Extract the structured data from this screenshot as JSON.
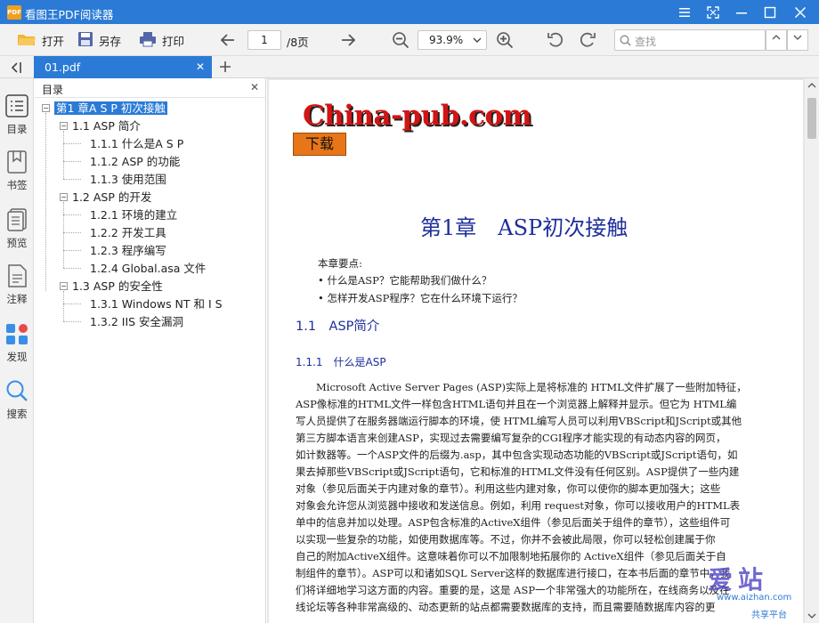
{
  "window": {
    "title": "看图王PDF阅读器",
    "app_icon": "PDF"
  },
  "toolbar": {
    "open_label": "打开",
    "save_label": "另存",
    "print_label": "打印",
    "page_current": "1",
    "page_total": "/8页",
    "zoom": "93.9%",
    "search_placeholder": "查找"
  },
  "tabs": [
    {
      "label": "01.pdf"
    }
  ],
  "rail": {
    "toc": "目录",
    "bookmark": "书签",
    "preview": "预览",
    "annotate": "注释",
    "discover": "发现",
    "search": "搜索"
  },
  "outline": {
    "title": "目录",
    "items": [
      {
        "label": "第1 章A S P 初次接触",
        "level": 0,
        "selected": true
      },
      {
        "label": "1.1 ASP 简介",
        "level": 1
      },
      {
        "label": "1.1.1 什么是A S P",
        "level": 2
      },
      {
        "label": "1.1.2 ASP 的功能",
        "level": 2
      },
      {
        "label": "1.1.3 使用范围",
        "level": 2
      },
      {
        "label": "1.2 ASP 的开发",
        "level": 1
      },
      {
        "label": "1.2.1 环境的建立",
        "level": 2
      },
      {
        "label": "1.2.2 开发工具",
        "level": 2
      },
      {
        "label": "1.2.3 程序编写",
        "level": 2
      },
      {
        "label": "1.2.4 Global.asa 文件",
        "level": 2
      },
      {
        "label": "1.3 ASP 的安全性",
        "level": 1
      },
      {
        "label": "1.3.1 Windows NT 和 I S",
        "level": 2
      },
      {
        "label": "1.3.2 IIS 安全漏洞",
        "level": 2
      }
    ]
  },
  "document": {
    "logo": "China-pub.com",
    "download": "下载",
    "chapter_title": "第1章　ASP初次接触",
    "key_head": "本章要点:",
    "key_points": [
      "• 什么是ASP？它能帮助我们做什么？",
      "• 怎样开发ASP程序？它在什么环境下运行？"
    ],
    "sec_1_1": "1.1　ASP简介",
    "sec_1_1_1": "1.1.1　什么是ASP",
    "paragraph_lines": [
      "　　Microsoft Active Server Pages (ASP)实际上是将标准的 HTML文件扩展了一些附加特征，",
      "ASP像标准的HTML文件一样包含HTML语句并且在一个浏览器上解释并显示。但它为 HTML编",
      "写人员提供了在服务器端运行脚本的环境，使 HTML编写人员可以利用VBScript和JScript或其他",
      "第三方脚本语言来创建ASP，实现过去需要编写复杂的CGI程序才能实现的有动态内容的网页，",
      "如计数器等。一个ASP文件的后缀为.asp，其中包含实现动态功能的VBScript或JScript语句，如",
      "果去掉那些VBScript或JScript语句，它和标准的HTML文件没有任何区别。ASP提供了一些内建",
      "对象（参见后面关于内建对象的章节）。利用这些内建对象，你可以使你的脚本更加强大；这些",
      "对象会允许您从浏览器中接收和发送信息。例如，利用 request对象，你可以接收用户的HTML表",
      "单中的信息并加以处理。ASP包含标准的ActiveX组件（参见后面关于组件的章节），这些组件可",
      "以实现一些复杂的功能，如使用数据库等。不过，你并不会被此局限，你可以轻松创建属于你",
      "自己的附加ActiveX组件。这意味着你可以不加限制地拓展你的 ActiveX组件（参见后面关于自",
      "制组件的章节）。ASP可以和诸如SQL Server这样的数据库进行接口，在本书后面的章节中，我",
      "们将详细地学习这方面的内容。重要的是，这是 ASP一个非常强大的功能所在，在线商务以及在",
      "线论坛等各种非常高级的、动态更新的站点都需要数据库的支持，而且需要随数据库内容的更"
    ]
  },
  "watermark": {
    "text": "爱站",
    "url": "www.aizhan.com",
    "tag": "共享平台"
  },
  "colors": {
    "accent": "#2b7bd6",
    "heading": "#1e2f9a",
    "logo_red": "#d21414",
    "download_orange": "#e87618"
  }
}
